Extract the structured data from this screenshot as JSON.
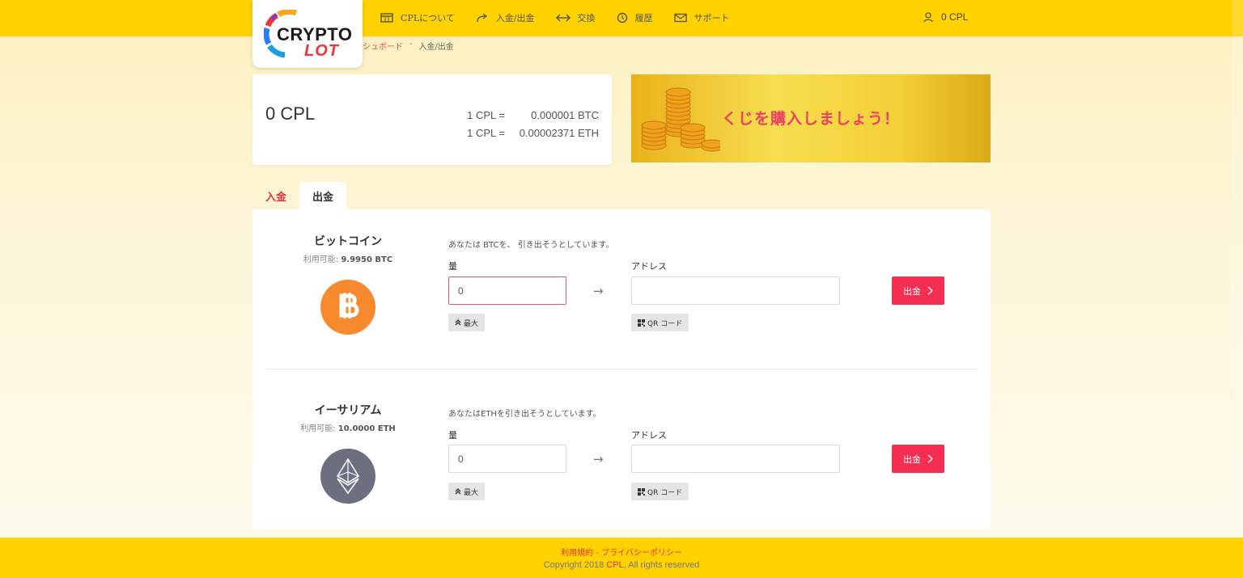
{
  "logo": {
    "word_top": "CRYPTO",
    "word_bottom": "LOT"
  },
  "nav": {
    "about": "CPLについて",
    "deposit_withdraw": "入金/出金",
    "exchange": "交換",
    "history": "履歴",
    "support": "サポート"
  },
  "user": {
    "balance": "0 CPL"
  },
  "breadcrumb": {
    "parent": "シュボード",
    "separator": "-",
    "current": "入金/出金"
  },
  "balance_card": {
    "value": "0 CPL",
    "rates": [
      {
        "unit": "1 CPL =",
        "value": "0.000001 BTC"
      },
      {
        "unit": "1 CPL =",
        "value": "0.00002371 ETH"
      }
    ]
  },
  "banner": {
    "text": "くじを購入しましょう！"
  },
  "tabs": {
    "deposit": "入金",
    "withdraw": "出金"
  },
  "coins": [
    {
      "name": "ビットコイン",
      "available_label": "利用可能:",
      "available_value": "9.9950 BTC",
      "notice": "あなたは BTCを、 引き出そうとしています。",
      "amount_label": "量",
      "amount_value": "0",
      "address_label": "アドレス",
      "address_value": "",
      "arrow": "→",
      "max_label": "最大",
      "qr_label": "QR コード",
      "submit_label": "出金"
    },
    {
      "name": "イーサリアム",
      "available_label": "利用可能:",
      "available_value": "10.0000 ETH",
      "notice": "あなたはETHを引き出そうとしています。",
      "amount_label": "量",
      "amount_value": "0",
      "address_label": "アドレス",
      "address_value": "",
      "arrow": "→",
      "max_label": "最大",
      "qr_label": "QR コード",
      "submit_label": "出金"
    }
  ],
  "footer": {
    "terms": "利用規約",
    "sep": "-",
    "privacy": "プライバシーポリシー",
    "copyright_prefix": "Copyright 2018",
    "brand": "CPL",
    "copyright_suffix": ", All rights reserved"
  },
  "colors": {
    "header": "#ffd200",
    "accent_red": "#f52e52",
    "btc": "#f7892e",
    "eth": "#6b6f80"
  }
}
